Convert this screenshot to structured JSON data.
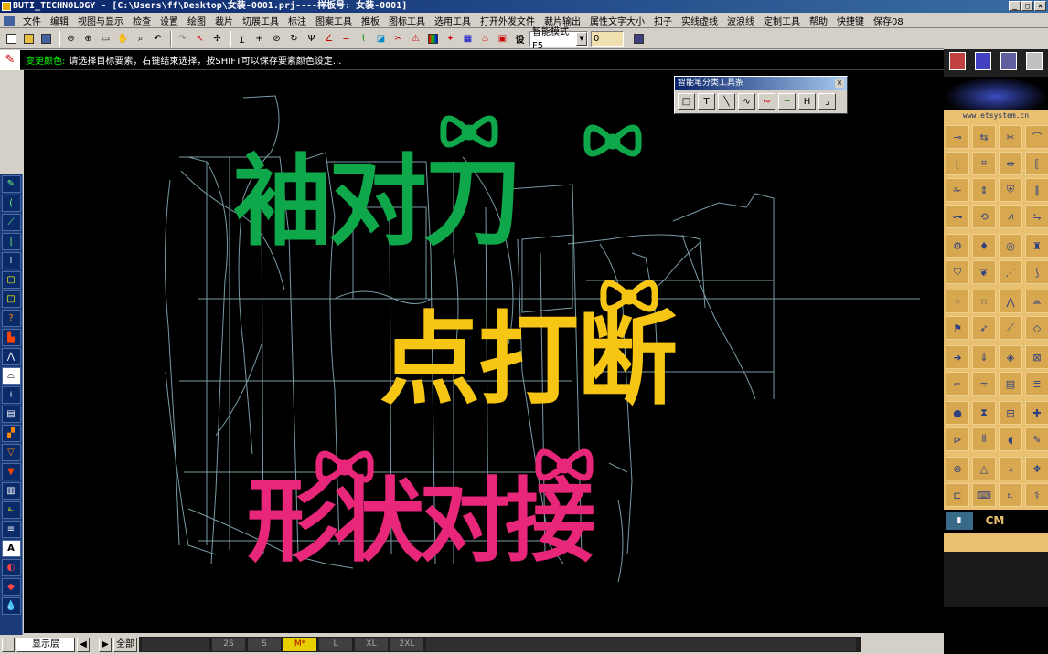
{
  "window": {
    "title": "BUTI_TECHNOLOGY - [C:\\Users\\ff\\Desktop\\女装-0001.prj----样板号: 女装-0001]"
  },
  "menu": [
    "文件",
    "编辑",
    "视图与显示",
    "检查",
    "设置",
    "绘图",
    "裁片",
    "切展工具",
    "标注",
    "图案工具",
    "推板",
    "图标工具",
    "选用工具",
    "打开外发文件",
    "裁片输出",
    "属性文字大小",
    "扣子",
    "实线虚线",
    "波浪线",
    "定制工具",
    "帮助",
    "快捷键",
    "保存08"
  ],
  "toolbar": {
    "mode_select": "智能模式F5",
    "value_field": "0"
  },
  "status": {
    "label": "变更颜色:",
    "message": "请选择目标要素，右键结束选择，按SHIFT可以保存要素颜色设定..."
  },
  "float_toolbar": {
    "title": "智能笔分类工具条"
  },
  "overlay": {
    "line1": "袖对刀",
    "line2": "点打断",
    "line3": "形状对接",
    "colors": {
      "line1": "#0ea84a",
      "line2": "#f7c514",
      "line3": "#e8267a"
    }
  },
  "right_panel": {
    "url": "www.etsystem.cn",
    "cm_label": "CM"
  },
  "bottom": {
    "layer": "显示层",
    "all": "全部",
    "sizes": [
      "2S",
      "S",
      "M*",
      "L",
      "XL",
      "2XL"
    ],
    "active_size": "M*"
  }
}
